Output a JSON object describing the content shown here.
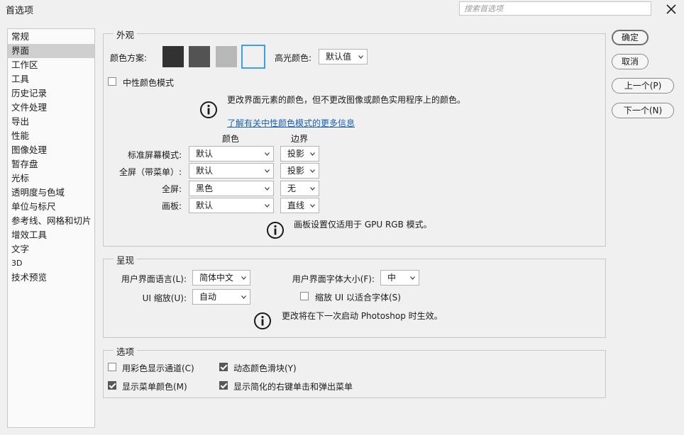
{
  "window": {
    "title": "首选项",
    "search_placeholder": "搜索首选项"
  },
  "sidebar": {
    "items": [
      "常规",
      "界面",
      "工作区",
      "工具",
      "历史记录",
      "文件处理",
      "导出",
      "性能",
      "图像处理",
      "暂存盘",
      "光标",
      "透明度与色域",
      "单位与标尺",
      "参考线、网格和切片",
      "增效工具",
      "文字",
      "3D",
      "技术预览"
    ],
    "selected": "界面"
  },
  "buttons": {
    "ok": "确定",
    "cancel": "取消",
    "prev": "上一个(P)",
    "next": "下一个(N)"
  },
  "appearance": {
    "legend": "外观",
    "color_theme_label": "颜色方案:",
    "swatches": [
      "#323232",
      "#535353",
      "#b8b8b8",
      "#f0f0f0"
    ],
    "selected_swatch_border": "#3aa0e6",
    "highlight_label": "高光颜色:",
    "highlight_value": "默认值",
    "neutral_mode_label": "中性颜色模式",
    "neutral_note": "更改界面元素的颜色，但不更改图像或颜色实用程序上的颜色。",
    "neutral_link": "了解有关中性颜色模式的更多信息",
    "col_color": "颜色",
    "col_border": "边界",
    "rows": [
      {
        "label": "标准屏幕模式:",
        "color": "默认",
        "border": "投影"
      },
      {
        "label": "全屏（带菜单）:",
        "color": "默认",
        "border": "投影"
      },
      {
        "label": "全屏:",
        "color": "黑色",
        "border": "无"
      },
      {
        "label": "画板:",
        "color": "默认",
        "border": "直线"
      }
    ],
    "artboard_note": "画板设置仅适用于 GPU RGB 模式。"
  },
  "presentation": {
    "legend": "呈现",
    "ui_language_label": "用户界面语言(L):",
    "ui_language_value": "简体中文",
    "ui_font_size_label": "用户界面字体大小(F):",
    "ui_font_size_value": "中",
    "ui_scale_label": "UI 缩放(U):",
    "ui_scale_value": "自动",
    "scale_to_font_label": "缩放 UI 以适合字体(S)",
    "restart_note": "更改将在下一次启动 Photoshop 时生效。"
  },
  "options": {
    "legend": "选项",
    "show_channels_color": {
      "label": "用彩色显示通道(C)",
      "checked": false
    },
    "dynamic_sliders": {
      "label": "动态颜色滑块(Y)",
      "checked": true
    },
    "show_menu_colors": {
      "label": "显示菜单颜色(M)",
      "checked": true
    },
    "simplified_menus": {
      "label": "显示简化的右键单击和弹出菜单",
      "checked": true
    }
  }
}
